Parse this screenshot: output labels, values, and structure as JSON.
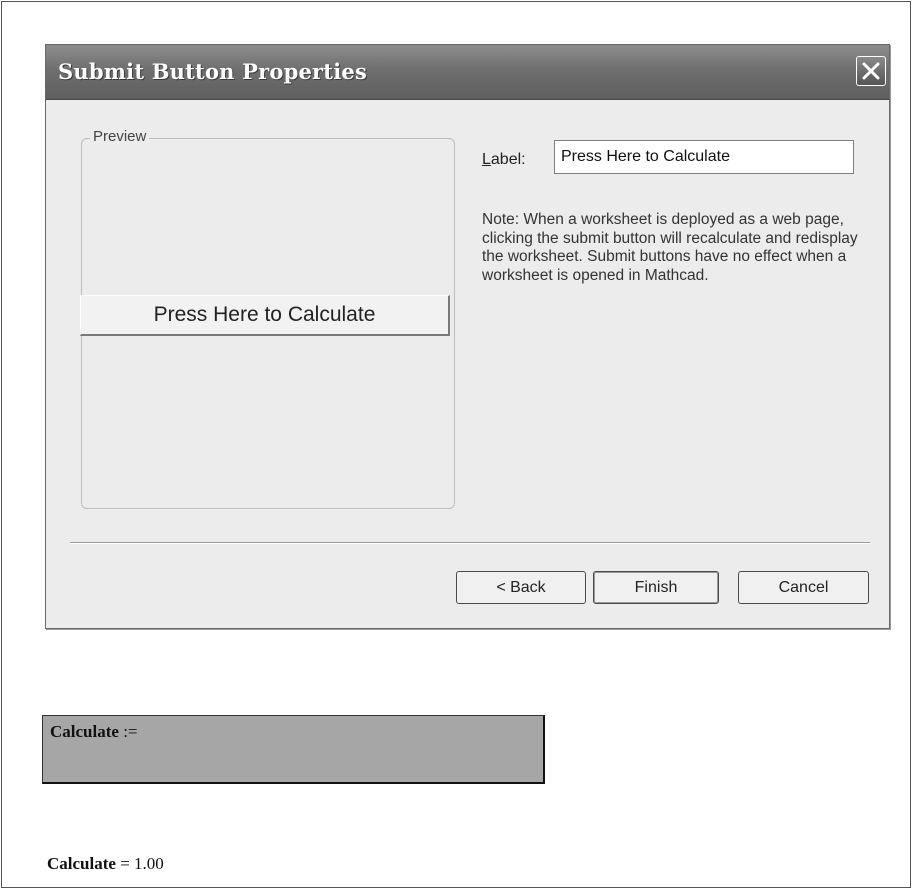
{
  "dialog": {
    "title": "Submit Button Properties",
    "close_icon": "close-icon",
    "preview": {
      "legend": "Preview",
      "button_label": "Press Here to Calculate"
    },
    "label_field": {
      "label": "Label:",
      "value": "Press Here to Calculate"
    },
    "note": "Note: When a worksheet is deployed as a web page, clicking the submit button will recalculate and redisplay the worksheet. Submit buttons have no effect when a worksheet is opened in Mathcad.",
    "buttons": {
      "back": "< Back",
      "finish": "Finish",
      "cancel": "Cancel"
    }
  },
  "worksheet": {
    "definition": {
      "variable": "Calculate",
      "operator": ":="
    },
    "result": {
      "variable": "Calculate",
      "operator": "=",
      "value": "1.00"
    }
  },
  "colors": {
    "titlebar": "#6f6f6f",
    "dialog_bg": "#ececec",
    "control_box": "#a6a6a6"
  }
}
